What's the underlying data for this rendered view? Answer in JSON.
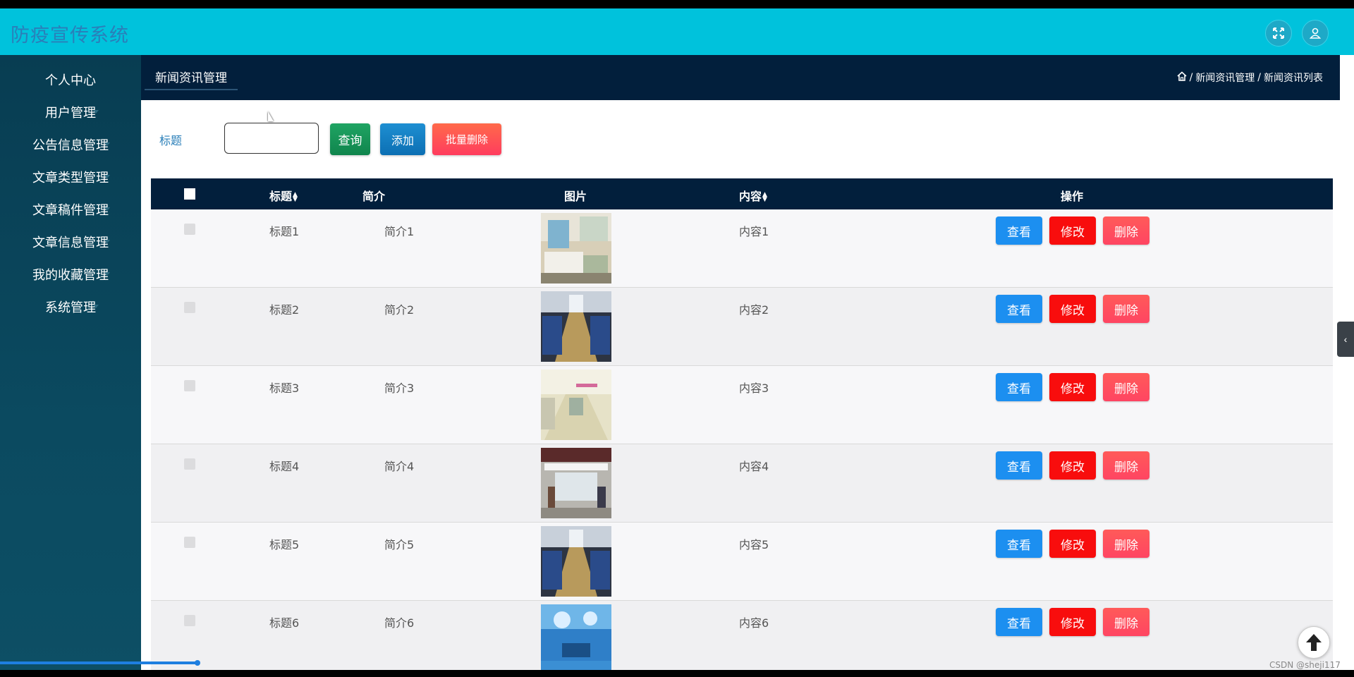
{
  "app": {
    "title": "防疫宣传系统",
    "fullscreen_icon": "fullscreen-icon",
    "user_icon": "user-icon"
  },
  "sidebar": {
    "items": [
      {
        "label": "个人中心",
        "caret": false
      },
      {
        "label": "用户管理",
        "caret": true
      },
      {
        "label": "公告信息管理",
        "caret": true
      },
      {
        "label": "文章类型管理",
        "caret": true
      },
      {
        "label": "文章稿件管理",
        "caret": true
      },
      {
        "label": "文章信息管理",
        "caret": true
      },
      {
        "label": "我的收藏管理",
        "caret": true
      },
      {
        "label": "系统管理",
        "caret": true
      }
    ]
  },
  "header": {
    "tab_label": "新闻资讯管理",
    "breadcrumb": {
      "home_icon": "home-icon",
      "items": [
        "新闻资讯管理",
        "新闻资讯列表"
      ],
      "separator": "/"
    }
  },
  "search": {
    "label": "标题",
    "input_value": "",
    "query_label": "查询",
    "add_label": "添加",
    "batch_delete_label": "批量删除"
  },
  "table": {
    "columns": [
      "标题",
      "简介",
      "图片",
      "内容",
      "操作"
    ],
    "rows": [
      {
        "title": "标题1",
        "intro": "简介1",
        "content": "内容1",
        "image": "hospital-ward-photo"
      },
      {
        "title": "标题2",
        "intro": "简介2",
        "content": "内容2",
        "image": "infusion-room-photo"
      },
      {
        "title": "标题3",
        "intro": "简介3",
        "content": "内容3",
        "image": "hospital-corridor-photo"
      },
      {
        "title": "标题4",
        "intro": "简介4",
        "content": "内容4",
        "image": "hospital-lobby-photo"
      },
      {
        "title": "标题5",
        "intro": "简介5",
        "content": "内容5",
        "image": "infusion-room-photo"
      },
      {
        "title": "标题6",
        "intro": "简介6",
        "content": "内容6",
        "image": "operating-room-photo"
      }
    ],
    "actions": {
      "view": "查看",
      "edit": "修改",
      "delete": "删除"
    }
  },
  "footer": {
    "watermark": "CSDN @sheji117",
    "scroll_top_icon": "arrow-up-icon",
    "collapse_icon": "chevron-left-icon"
  },
  "colors": {
    "topbar": "#00c2dc",
    "sidebar": "#0b4a60",
    "header": "#021f3c",
    "view": "#1c8ff0",
    "edit": "#f80d0d",
    "delete": "#ff4562"
  }
}
